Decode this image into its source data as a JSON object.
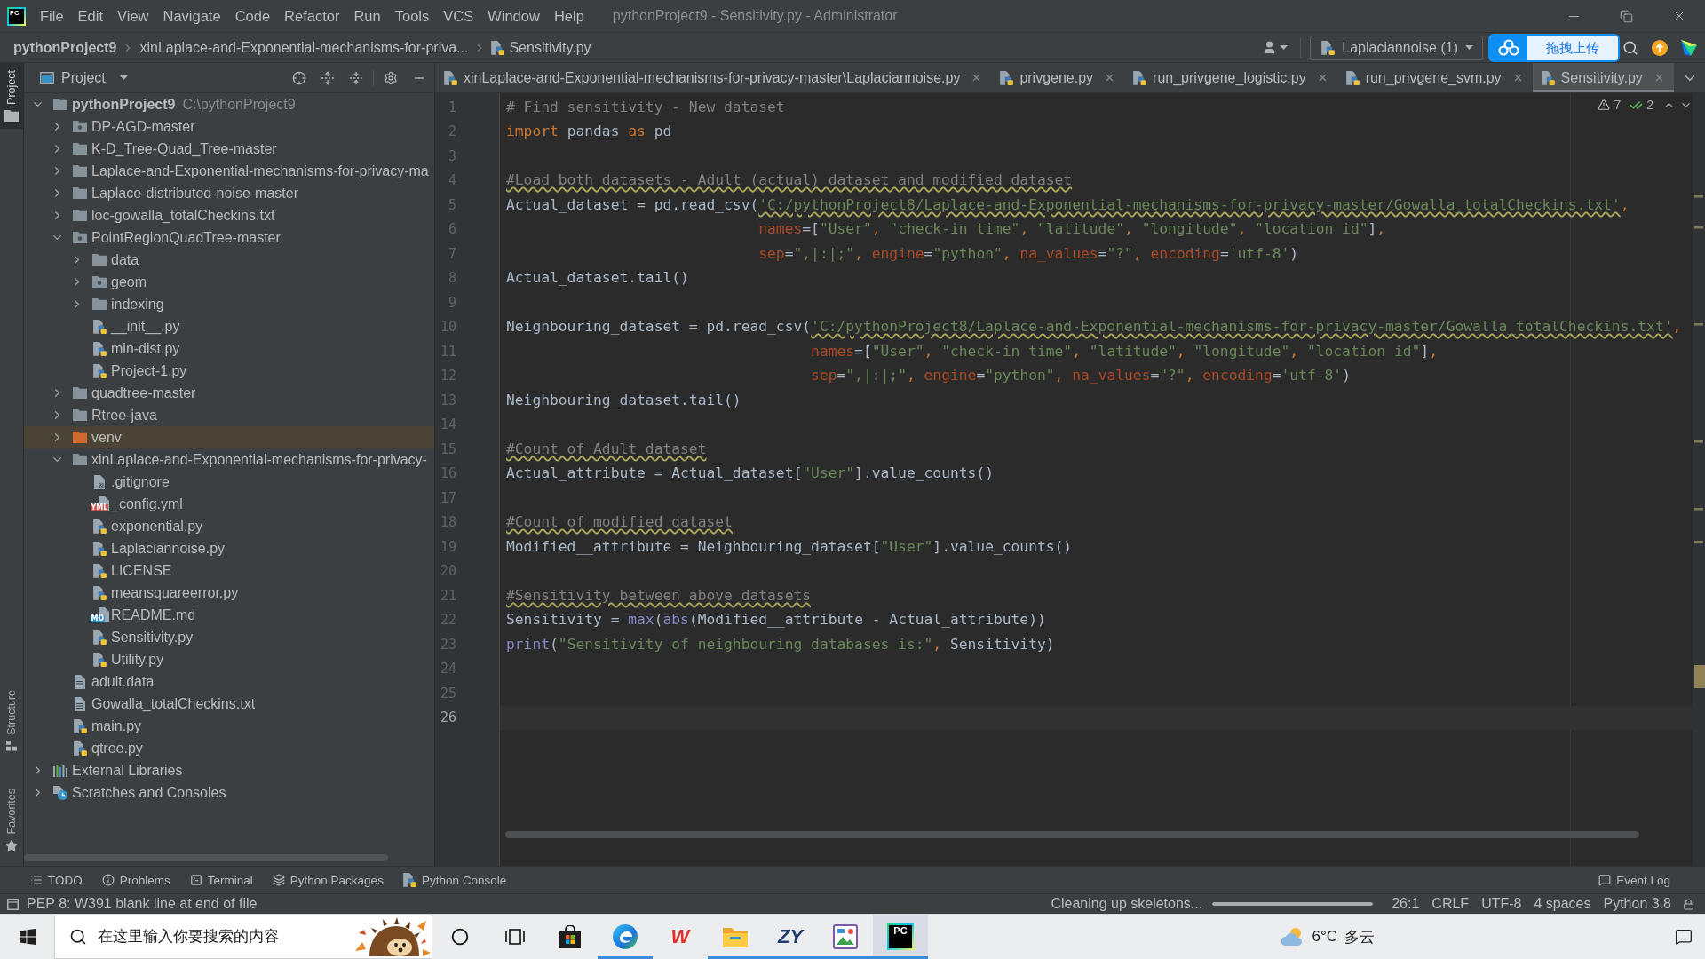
{
  "window": {
    "title": "pythonProject9 - Sensitivity.py - Administrator",
    "app_logo": "PC"
  },
  "menu": [
    "File",
    "Edit",
    "View",
    "Navigate",
    "Code",
    "Refactor",
    "Run",
    "Tools",
    "VCS",
    "Window",
    "Help"
  ],
  "breadcrumbs": [
    {
      "label": "pythonProject9",
      "kind": "project"
    },
    {
      "label": "xinLaplace-and-Exponential-mechanisms-for-priva...",
      "kind": "folder"
    },
    {
      "label": "Sensitivity.py",
      "kind": "python"
    }
  ],
  "run_config": {
    "label": "Laplaciannoise (1)"
  },
  "upload_widget": {
    "label": "拖拽上传"
  },
  "side_tabs": [
    {
      "label": "Project",
      "kind": "project",
      "selected": true
    },
    {
      "label": "Structure",
      "kind": "structure",
      "selected": false
    },
    {
      "label": "Favorites",
      "kind": "favorites",
      "selected": false
    }
  ],
  "project_panel": {
    "title": "Project",
    "tree": [
      {
        "name": "pythonProject9",
        "path": "C:\\pythonProject9",
        "kind": "project",
        "expanded": true,
        "selected": false,
        "children": [
          {
            "name": "DP-AGD-master",
            "kind": "package",
            "expanded": false,
            "selected": false
          },
          {
            "name": "K-D_Tree-Quad_Tree-master",
            "kind": "folder",
            "expanded": false,
            "selected": false
          },
          {
            "name": "Laplace-and-Exponential-mechanisms-for-privacy-ma",
            "kind": "folder",
            "expanded": false,
            "selected": false
          },
          {
            "name": "Laplace-distributed-noise-master",
            "kind": "folder",
            "expanded": false,
            "selected": false
          },
          {
            "name": "loc-gowalla_totalCheckins.txt",
            "kind": "folder",
            "expanded": false,
            "selected": false
          },
          {
            "name": "PointRegionQuadTree-master",
            "kind": "package",
            "expanded": true,
            "selected": false,
            "children": [
              {
                "name": "data",
                "kind": "folder",
                "expanded": false,
                "selected": false
              },
              {
                "name": "geom",
                "kind": "package",
                "expanded": false,
                "selected": false
              },
              {
                "name": "indexing",
                "kind": "folder",
                "expanded": false,
                "selected": false
              },
              {
                "name": "__init__.py",
                "kind": "python",
                "selected": false
              },
              {
                "name": "min-dist.py",
                "kind": "python",
                "selected": false
              },
              {
                "name": "Project-1.py",
                "kind": "python",
                "selected": false
              }
            ]
          },
          {
            "name": "quadtree-master",
            "kind": "folder",
            "expanded": false,
            "selected": false
          },
          {
            "name": "Rtree-java",
            "kind": "folder",
            "expanded": false,
            "selected": false
          },
          {
            "name": "venv",
            "kind": "excluded",
            "expanded": false,
            "selected": true
          },
          {
            "name": "xinLaplace-and-Exponential-mechanisms-for-privacy-",
            "kind": "folder",
            "expanded": true,
            "selected": false,
            "children": [
              {
                "name": ".gitignore",
                "kind": "ignore",
                "selected": false
              },
              {
                "name": "_config.yml",
                "kind": "yml",
                "badge": "YML",
                "selected": false
              },
              {
                "name": "exponential.py",
                "kind": "python",
                "selected": false
              },
              {
                "name": "Laplaciannoise.py",
                "kind": "python",
                "selected": false
              },
              {
                "name": "LICENSE",
                "kind": "python",
                "selected": false
              },
              {
                "name": "meansquareerror.py",
                "kind": "python",
                "selected": false
              },
              {
                "name": "README.md",
                "kind": "md",
                "badge": "MD",
                "selected": false
              },
              {
                "name": "Sensitivity.py",
                "kind": "python",
                "selected": false
              },
              {
                "name": "Utility.py",
                "kind": "python",
                "selected": false
              }
            ]
          },
          {
            "name": "adult.data",
            "kind": "text",
            "selected": false
          },
          {
            "name": "Gowalla_totalCheckins.txt",
            "kind": "text",
            "selected": false
          },
          {
            "name": "main.py",
            "kind": "python",
            "selected": false
          },
          {
            "name": "qtree.py",
            "kind": "python",
            "selected": false
          }
        ]
      },
      {
        "name": "External Libraries",
        "kind": "libraries",
        "expanded": false,
        "selected": false
      },
      {
        "name": "Scratches and Consoles",
        "kind": "scratches",
        "expanded": false,
        "selected": false
      }
    ]
  },
  "editor_tabs": [
    {
      "label": "xinLaplace-and-Exponential-mechanisms-for-privacy-master\\Laplaciannoise.py",
      "selected": false
    },
    {
      "label": "privgene.py",
      "selected": false
    },
    {
      "label": "run_privgene_logistic.py",
      "selected": false
    },
    {
      "label": "run_privgene_svm.py",
      "selected": false
    },
    {
      "label": "Sensitivity.py",
      "selected": true
    }
  ],
  "editor": {
    "inspections": [
      {
        "kind": "warning",
        "count": "7"
      },
      {
        "kind": "weak_warning",
        "count": "2"
      }
    ],
    "lines": [
      {
        "number": "1",
        "current": false,
        "tokens": [
          {
            "text": "# Find sensitivity - New dataset",
            "kind": "comment",
            "squiggle": false
          }
        ]
      },
      {
        "number": "2",
        "current": false,
        "tokens": [
          {
            "text": "import",
            "kind": "keyword",
            "squiggle": false
          },
          {
            "text": " pandas ",
            "kind": "text",
            "squiggle": false
          },
          {
            "text": "as",
            "kind": "keyword",
            "squiggle": false
          },
          {
            "text": " pd",
            "kind": "text",
            "squiggle": false
          }
        ]
      },
      {
        "number": "3",
        "current": false
      },
      {
        "number": "4",
        "current": false,
        "tokens": [
          {
            "text": "#Load both datasets - Adult (actual) dataset and modified dataset",
            "kind": "comment",
            "squiggle": true
          }
        ]
      },
      {
        "number": "5",
        "current": false,
        "tokens": [
          {
            "text": "Actual_dataset = pd.read_csv(",
            "kind": "text",
            "squiggle": false
          },
          {
            "text": "'C:/pythonProject8/Laplace-and-Exponential-mechanisms-for-privacy-master/Gowalla_totalCheckins.txt'",
            "kind": "string",
            "squiggle": true
          },
          {
            "text": ",",
            "kind": "comma",
            "squiggle": false
          }
        ]
      },
      {
        "number": "6",
        "current": false,
        "tokens": [
          {
            "text": "                             names",
            "kind": "param",
            "squiggle": false
          },
          {
            "text": "=[",
            "kind": "text",
            "squiggle": false
          },
          {
            "text": "\"User\"",
            "kind": "string",
            "squiggle": false
          },
          {
            "text": ", ",
            "kind": "comma",
            "squiggle": false
          },
          {
            "text": "\"check-in time\"",
            "kind": "string",
            "squiggle": false
          },
          {
            "text": ", ",
            "kind": "comma",
            "squiggle": false
          },
          {
            "text": "\"latitude\"",
            "kind": "string",
            "squiggle": false
          },
          {
            "text": ", ",
            "kind": "comma",
            "squiggle": false
          },
          {
            "text": "\"longitude\"",
            "kind": "string",
            "squiggle": false
          },
          {
            "text": ", ",
            "kind": "comma",
            "squiggle": false
          },
          {
            "text": "\"location id\"",
            "kind": "string",
            "squiggle": false
          },
          {
            "text": "]",
            "kind": "text",
            "squiggle": false
          },
          {
            "text": ",",
            "kind": "comma",
            "squiggle": false
          }
        ]
      },
      {
        "number": "7",
        "current": false,
        "tokens": [
          {
            "text": "                             sep",
            "kind": "param",
            "squiggle": false
          },
          {
            "text": "=",
            "kind": "text",
            "squiggle": false
          },
          {
            "text": "\",|:|;\"",
            "kind": "string",
            "squiggle": false
          },
          {
            "text": ", ",
            "kind": "comma",
            "squiggle": false
          },
          {
            "text": "engine",
            "kind": "param",
            "squiggle": false
          },
          {
            "text": "=",
            "kind": "text",
            "squiggle": false
          },
          {
            "text": "\"python\"",
            "kind": "string",
            "squiggle": false
          },
          {
            "text": ", ",
            "kind": "comma",
            "squiggle": false
          },
          {
            "text": "na_values",
            "kind": "param",
            "squiggle": false
          },
          {
            "text": "=",
            "kind": "text",
            "squiggle": false
          },
          {
            "text": "\"?\"",
            "kind": "string",
            "squiggle": false
          },
          {
            "text": ", ",
            "kind": "comma",
            "squiggle": false
          },
          {
            "text": "encoding",
            "kind": "param",
            "squiggle": false
          },
          {
            "text": "=",
            "kind": "text",
            "squiggle": false
          },
          {
            "text": "'utf-8'",
            "kind": "string",
            "squiggle": false
          },
          {
            "text": ")",
            "kind": "text",
            "squiggle": false
          }
        ]
      },
      {
        "number": "8",
        "current": false,
        "tokens": [
          {
            "text": "Actual_dataset.tail()",
            "kind": "text",
            "squiggle": false
          }
        ]
      },
      {
        "number": "9",
        "current": false
      },
      {
        "number": "10",
        "current": false,
        "tokens": [
          {
            "text": "Neighbouring_dataset = pd.read_csv(",
            "kind": "text",
            "squiggle": false
          },
          {
            "text": "'C:/pythonProject8/Laplace-and-Exponential-mechanisms-for-privacy-master/Gowalla_totalCheckins.txt'",
            "kind": "string",
            "squiggle": true
          },
          {
            "text": ",",
            "kind": "comma",
            "squiggle": false
          }
        ]
      },
      {
        "number": "11",
        "current": false,
        "tokens": [
          {
            "text": "                                   names",
            "kind": "param",
            "squiggle": false
          },
          {
            "text": "=[",
            "kind": "text",
            "squiggle": false
          },
          {
            "text": "\"User\"",
            "kind": "string",
            "squiggle": false
          },
          {
            "text": ", ",
            "kind": "comma",
            "squiggle": false
          },
          {
            "text": "\"check-in time\"",
            "kind": "string",
            "squiggle": false
          },
          {
            "text": ", ",
            "kind": "comma",
            "squiggle": false
          },
          {
            "text": "\"latitude\"",
            "kind": "string",
            "squiggle": false
          },
          {
            "text": ", ",
            "kind": "comma",
            "squiggle": false
          },
          {
            "text": "\"longitude\"",
            "kind": "string",
            "squiggle": false
          },
          {
            "text": ", ",
            "kind": "comma",
            "squiggle": false
          },
          {
            "text": "\"location id\"",
            "kind": "string",
            "squiggle": false
          },
          {
            "text": "]",
            "kind": "text",
            "squiggle": false
          },
          {
            "text": ",",
            "kind": "comma",
            "squiggle": false
          }
        ]
      },
      {
        "number": "12",
        "current": false,
        "tokens": [
          {
            "text": "                                   sep",
            "kind": "param",
            "squiggle": false
          },
          {
            "text": "=",
            "kind": "text",
            "squiggle": false
          },
          {
            "text": "\",|:|;\"",
            "kind": "string",
            "squiggle": false
          },
          {
            "text": ", ",
            "kind": "comma",
            "squiggle": false
          },
          {
            "text": "engine",
            "kind": "param",
            "squiggle": false
          },
          {
            "text": "=",
            "kind": "text",
            "squiggle": false
          },
          {
            "text": "\"python\"",
            "kind": "string",
            "squiggle": false
          },
          {
            "text": ", ",
            "kind": "comma",
            "squiggle": false
          },
          {
            "text": "na_values",
            "kind": "param",
            "squiggle": false
          },
          {
            "text": "=",
            "kind": "text",
            "squiggle": false
          },
          {
            "text": "\"?\"",
            "kind": "string",
            "squiggle": false
          },
          {
            "text": ", ",
            "kind": "comma",
            "squiggle": false
          },
          {
            "text": "encoding",
            "kind": "param",
            "squiggle": false
          },
          {
            "text": "=",
            "kind": "text",
            "squiggle": false
          },
          {
            "text": "'utf-8'",
            "kind": "string",
            "squiggle": false
          },
          {
            "text": ")",
            "kind": "text",
            "squiggle": false
          }
        ]
      },
      {
        "number": "13",
        "current": false,
        "tokens": [
          {
            "text": "Neighbouring_dataset.tail()",
            "kind": "text",
            "squiggle": false
          }
        ]
      },
      {
        "number": "14",
        "current": false
      },
      {
        "number": "15",
        "current": false,
        "tokens": [
          {
            "text": "#Count of Adult dataset",
            "kind": "comment",
            "squiggle": true
          }
        ]
      },
      {
        "number": "16",
        "current": false,
        "tokens": [
          {
            "text": "Actual_attribute = Actual_dataset[",
            "kind": "text",
            "squiggle": false
          },
          {
            "text": "\"User\"",
            "kind": "string",
            "squiggle": false
          },
          {
            "text": "].value_counts()",
            "kind": "text",
            "squiggle": false
          }
        ]
      },
      {
        "number": "17",
        "current": false
      },
      {
        "number": "18",
        "current": false,
        "tokens": [
          {
            "text": "#Count of modified dataset",
            "kind": "comment",
            "squiggle": true
          }
        ]
      },
      {
        "number": "19",
        "current": false,
        "tokens": [
          {
            "text": "Modified__attribute = Neighbouring_dataset[",
            "kind": "text",
            "squiggle": false
          },
          {
            "text": "\"User\"",
            "kind": "string",
            "squiggle": false
          },
          {
            "text": "].value_counts()",
            "kind": "text",
            "squiggle": false
          }
        ]
      },
      {
        "number": "20",
        "current": false
      },
      {
        "number": "21",
        "current": false,
        "tokens": [
          {
            "text": "#Sensitivity between above datasets",
            "kind": "comment",
            "squiggle": true
          }
        ]
      },
      {
        "number": "22",
        "current": false,
        "tokens": [
          {
            "text": "Sensitivity = ",
            "kind": "text",
            "squiggle": false
          },
          {
            "text": "max",
            "kind": "builtin",
            "squiggle": false
          },
          {
            "text": "(",
            "kind": "text",
            "squiggle": false
          },
          {
            "text": "abs",
            "kind": "builtin",
            "squiggle": false
          },
          {
            "text": "(Modified__attribute - Actual_attribute))",
            "kind": "text",
            "squiggle": false
          }
        ]
      },
      {
        "number": "23",
        "current": false,
        "tokens": [
          {
            "text": "print",
            "kind": "builtin",
            "squiggle": false
          },
          {
            "text": "(",
            "kind": "text",
            "squiggle": false
          },
          {
            "text": "\"Sensitivity of neighbouring databases is:\"",
            "kind": "string",
            "squiggle": false
          },
          {
            "text": ",",
            "kind": "comma",
            "squiggle": false
          },
          {
            "text": " Sensitivity)",
            "kind": "text",
            "squiggle": false
          }
        ]
      },
      {
        "number": "24",
        "current": false
      },
      {
        "number": "25",
        "current": false
      },
      {
        "number": "26",
        "current": true
      }
    ]
  },
  "tool_windows": [
    {
      "label": "TODO",
      "kind": "todo"
    },
    {
      "label": "Problems",
      "kind": "problems"
    },
    {
      "label": "Terminal",
      "kind": "terminal"
    },
    {
      "label": "Python Packages",
      "kind": "packages"
    },
    {
      "label": "Python Console",
      "kind": "console"
    },
    {
      "label": "Event Log",
      "kind": "event_log"
    }
  ],
  "status_bar": {
    "message": "PEP 8: W391 blank line at end of file",
    "task": "Cleaning up skeletons...",
    "progress": {
      "level": 1
    },
    "items": [
      "26:1",
      "CRLF",
      "UTF-8",
      "4 spaces",
      "Python 3.8"
    ]
  },
  "taskbar": {
    "search": {
      "placeholder": "在这里输入你要搜索的内容"
    },
    "apps": [
      {
        "kind": "cortana",
        "running": false,
        "selected": false
      },
      {
        "kind": "task_view",
        "running": false,
        "selected": false
      },
      {
        "kind": "store",
        "running": false,
        "selected": false
      },
      {
        "kind": "browser",
        "running": true,
        "selected": false
      },
      {
        "kind": "wps",
        "label": "W",
        "running": false,
        "selected": false
      },
      {
        "kind": "explorer",
        "running": true,
        "selected": false
      },
      {
        "kind": "zy",
        "label": "ZY",
        "running": true,
        "selected": false
      },
      {
        "kind": "paint",
        "running": true,
        "selected": false
      },
      {
        "kind": "pycharm",
        "label": "PC",
        "running": true,
        "selected": true
      }
    ],
    "weather": {
      "temperature": "6°C",
      "condition": "多云"
    }
  }
}
